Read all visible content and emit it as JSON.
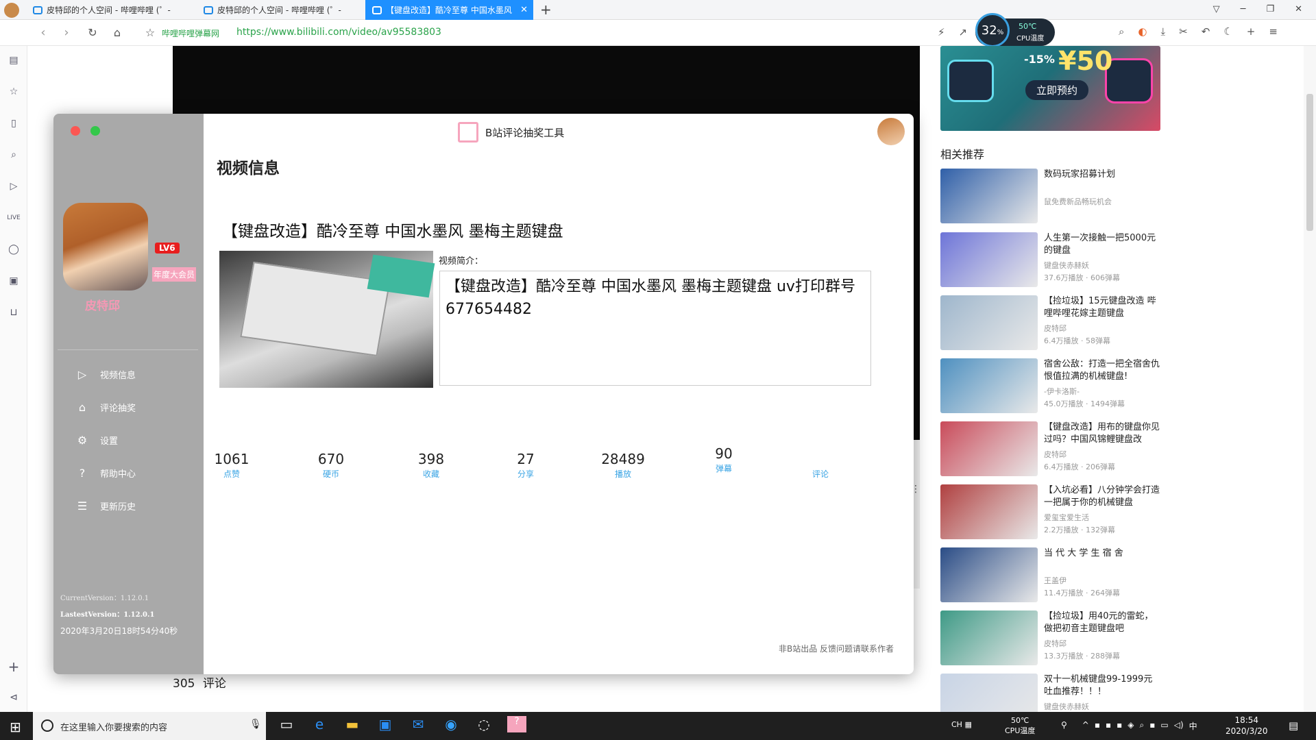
{
  "browser": {
    "tabs": [
      {
        "label": "皮特邱的个人空间 - 哔哩哔哩 (゜-",
        "active": false
      },
      {
        "label": "皮特邱的个人空间 - 哔哩哔哩 (゜-",
        "active": false
      },
      {
        "label": "【键盘改造】酷冷至尊 中国水墨风",
        "active": true
      }
    ],
    "new_tab": "+",
    "bookmark_label": "哔哩哔哩弹幕网",
    "url": "https://www.bilibili.com/video/av95583803",
    "cpu_percent": "32",
    "cpu_percent_unit": "%",
    "cpu_temp": "50℃",
    "cpu_temp_label": "CPU温度"
  },
  "page": {
    "related_title": "相关推荐",
    "ad_button": "立即预约",
    "ad_text": "¥50",
    "ad_discount": "-15%",
    "comments_count": "305",
    "comments_label": "评论",
    "related": [
      {
        "title": "数码玩家招募计划",
        "up": "鼠免费新品畅玩机会",
        "stats": "",
        "thumb": "#2f5fa8"
      },
      {
        "title": "人生第一次接触一把5000元的键盘",
        "up": "键盘侠赤赫妖",
        "stats": "37.6万播放 · 606弹幕",
        "thumb": "#6d74d8"
      },
      {
        "title": "【捡垃圾】15元键盘改造 哔哩哔哩花嫁主题键盘",
        "up": "皮特邱",
        "stats": "6.4万播放 · 58弹幕",
        "thumb": "#9eb6cc"
      },
      {
        "title": "宿舍公敌：打造一把全宿舍仇恨值拉满的机械键盘!",
        "up": "-伊卡洛斯-",
        "stats": "45.0万播放 · 1494弹幕",
        "thumb": "#4e90c0"
      },
      {
        "title": "【键盘改造】用布的键盘你见过吗？中国风锦鲤键盘改",
        "up": "皮特邱",
        "stats": "6.4万播放 · 206弹幕",
        "thumb": "#c94b5a"
      },
      {
        "title": "【入坑必看】八分钟学会打造一把属于你的机械键盘",
        "up": "爱玺宝爱生活",
        "stats": "2.2万播放 · 132弹幕",
        "thumb": "#b04040"
      },
      {
        "title": "当 代 大 学 生 宿 舍",
        "up": "王盖伊",
        "stats": "11.4万播放 · 264弹幕",
        "thumb": "#2a4c86"
      },
      {
        "title": "【捡垃圾】用40元的雷蛇，做把初音主题键盘吧",
        "up": "皮特邱",
        "stats": "13.3万播放 · 288弹幕",
        "thumb": "#3e9a86"
      },
      {
        "title": "双十一机械键盘99-1999元吐血推荐！！！",
        "up": "键盘侠赤赫妖",
        "stats": "",
        "thumb": "#c8d4e6"
      }
    ]
  },
  "app": {
    "title": "B站评论抽奖工具",
    "section_title": "视频信息",
    "user_name": "皮特邱",
    "level_badge": "LV6",
    "vip_badge": "年度大会员",
    "menu": [
      {
        "label": "视频信息",
        "icon": "video-icon"
      },
      {
        "label": "评论抽奖",
        "icon": "home-icon"
      },
      {
        "label": "设置",
        "icon": "gear-icon"
      },
      {
        "label": "帮助中心",
        "icon": "help-icon"
      },
      {
        "label": "更新历史",
        "icon": "history-icon"
      }
    ],
    "current_version": "CurrentVersion：1.12.0.1",
    "latest_version": "LastestVersion：1.12.0.1",
    "timestamp": "2020年3月20日18时54分40秒",
    "video_title": "【键盘改造】酷冷至尊 中国水墨风 墨梅主题键盘",
    "desc_label": "视频简介：",
    "desc_text": "【键盘改造】酷冷至尊 中国水墨风 墨梅主题键盘 uv打印群号 677654482",
    "stats": [
      {
        "value": "1061",
        "label": "点赞"
      },
      {
        "value": "670",
        "label": "硬币"
      },
      {
        "value": "398",
        "label": "收藏"
      },
      {
        "value": "27",
        "label": "分享"
      },
      {
        "value": "28489",
        "label": "播放"
      },
      {
        "value": "90",
        "label": "弹幕"
      },
      {
        "value": "",
        "label": "评论"
      }
    ],
    "footer": "非B站出品 反馈问题请联系作者"
  },
  "taskbar": {
    "search_placeholder": "在这里输入你要搜索的内容",
    "cpu_temp": "50℃",
    "cpu_label": "CPU温度",
    "ime": "中",
    "time": "18:54",
    "date": "2020/3/20"
  }
}
